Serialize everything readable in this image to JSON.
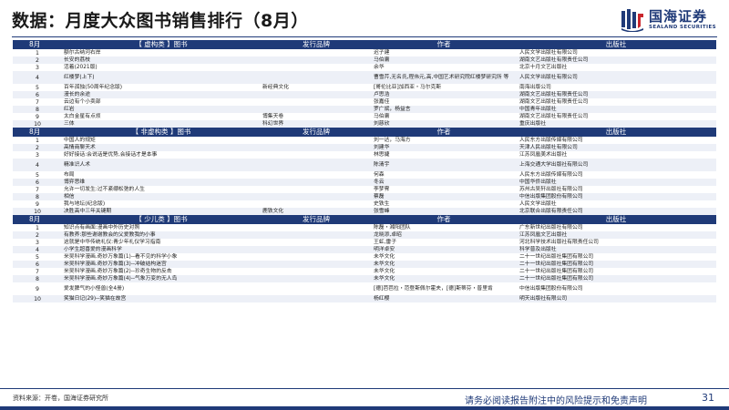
{
  "page": {
    "title": "数据：月度大众图书销售排行（8月）",
    "logo_cn": "国海证券",
    "logo_en": "SEALAND SECURITIES",
    "source": "资料来源：开卷，国海证券研究所",
    "disclaimer": "请务必阅读报告附注中的风险提示和免责声明",
    "page_number": "31"
  },
  "colors": {
    "brand": "#1f3a78",
    "row_alt": "#edf0f7"
  },
  "tables": [
    {
      "headers": [
        "8月",
        "【 虚构类 】图书",
        "发行品牌",
        "作者",
        "出版社"
      ],
      "rows": [
        [
          "1",
          "额尔古纳河右岸",
          "",
          "迟子建",
          "人民文学出版社有限公司"
        ],
        [
          "2",
          "长安的荔枝",
          "",
          "马伯庸",
          "湖南文艺出版社有限责任公司"
        ],
        [
          "3",
          "活着(2021版)",
          "",
          "余华",
          "北京十月文艺出版社"
        ],
        [
          "4",
          "红楼梦(上下)",
          "",
          "曹雪芹,无名氏,程伟元,高,中国艺术研究院红楼梦研究所 等",
          "人民文学出版社有限公司"
        ],
        [
          "5",
          "百年孤独(50周年纪念版)",
          "新经典文化",
          "[哥伦比亚]加西亚・马尔克斯",
          "南海出版公司"
        ],
        [
          "6",
          "漫长的余途",
          "",
          "卢思浩",
          "湖南文艺出版社有限责任公司"
        ],
        [
          "7",
          "云边有个小卖部",
          "",
          "张嘉佳",
          "湖南文艺出版社有限责任公司"
        ],
        [
          "8",
          "红岩",
          "",
          "罗广斌，杨益言",
          "中国青年出版社"
        ],
        [
          "9",
          "太白金星有点烦",
          "博集天卷",
          "马伯庸",
          "湖南文艺出版社有限责任公司"
        ],
        [
          "10",
          "三体",
          "科幻世界",
          "刘慈欣",
          "重庆出版社"
        ]
      ]
    },
    {
      "headers": [
        "8月",
        "【 非虚构类 】图书",
        "发行品牌",
        "作者",
        "出版社"
      ],
      "rows": [
        [
          "1",
          "中国人的规矩",
          "",
          "刘一达，马海方",
          "人民东方出版传媒有限公司"
        ],
        [
          "2",
          "高情商聊天术",
          "",
          "刘建华",
          "天津人民出版社有限公司"
        ],
        [
          "3",
          "好好接话:会说话是优势,会接话才是本事",
          "",
          "林思婕",
          "江苏凤凰美术出版社"
        ],
        [
          "4",
          "精准识人术",
          "",
          "陈清宇",
          "上海交通大学出版社有限公司"
        ],
        [
          "5",
          "布局",
          "",
          "何森",
          "人民东方出版传媒有限公司"
        ],
        [
          "6",
          "博弈思维",
          "",
          "冬云",
          "中国华侨出版社"
        ],
        [
          "7",
          "允许一切发生:过不紧绷松弛的人生",
          "",
          "李梦霁",
          "苏州古吴轩出版社有限公司"
        ],
        [
          "8",
          "相信",
          "",
          "蔡磊",
          "中信出版集团股份有限公司"
        ],
        [
          "9",
          "我与地坛(纪念版)",
          "",
          "史铁生",
          "人民文学出版社"
        ],
        [
          "10",
          "决胜高中三年关键期",
          "鹿铁文化",
          "张雪峰",
          "北京联合出版有限责任公司"
        ]
      ]
    },
    {
      "headers": [
        "8月",
        "【 少儿类 】图书",
        "发行品牌",
        "作者",
        "出版社"
      ],
      "rows": [
        [
          "1",
          "知识点有画面:漫画中外历史对照",
          "",
          "陈磊・湘阳团队",
          "广东新世纪出版社有限公司"
        ],
        [
          "2",
          "有教养:那些谢谢教会的父爱教我的小事",
          "",
          "龙晓添,卓昭",
          "江苏凤凰文艺出版社"
        ],
        [
          "3",
          "这就是中华传统礼仪:青少年礼仪学习指南",
          "",
          "王虹,雷子",
          "河北科学技术出版社有限责任公司"
        ],
        [
          "4",
          "小学生超喜爱的漫画科学",
          "",
          "明洋卓安",
          "科学普及出版社"
        ],
        [
          "5",
          "米吴科学漫画.奇妙万象篇(1)--看不见的科学小象",
          "",
          "未华文化",
          "二十一世纪出版社集团有限公司"
        ],
        [
          "6",
          "米吴科学漫画.奇妙万象篇(3)--冲破结构迷宫",
          "",
          "未华文化",
          "二十一世纪出版社集团有限公司"
        ],
        [
          "7",
          "米吴科学漫画.奇妙万象篇(2)--珍奇生物的反击",
          "",
          "未华文化",
          "二十一世纪出版社集团有限公司"
        ],
        [
          "8",
          "米吴科学漫画.奇妙万象篇(4)--气象万变的无人岛",
          "",
          "未华文化",
          "二十一世纪出版社集团有限公司"
        ],
        [
          "9",
          "爱发脾气的小怪兽(全4册)",
          "",
          "[德]芭芭拉・范登斯佩尔霍夫，[德]斯蒂芬・普里肯",
          "中信出版集团股份有限公司"
        ],
        [
          "10",
          "笑猫日记(29)--笑猫在故宫",
          "",
          "杨红樱",
          "明天出版社有限公司"
        ]
      ]
    }
  ]
}
